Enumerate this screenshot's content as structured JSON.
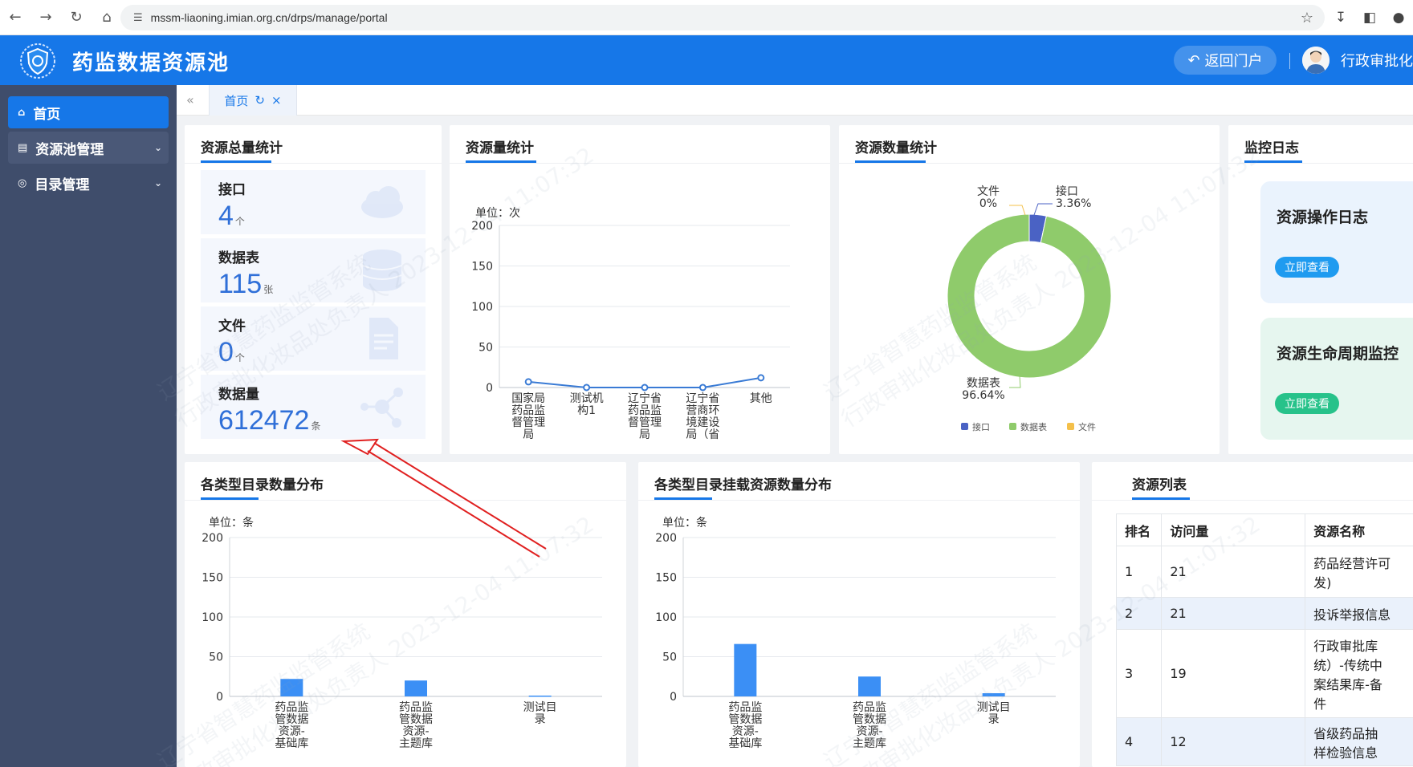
{
  "browser": {
    "url": "mssm-liaoning.imian.org.cn/drps/manage/portal"
  },
  "header": {
    "title": "药监数据资源池",
    "back_button": "返回门户",
    "user_name": "行政审批化"
  },
  "sidebar": {
    "items": [
      {
        "label": "首页"
      },
      {
        "label": "资源池管理"
      },
      {
        "label": "目录管理"
      }
    ]
  },
  "tabs": [
    {
      "label": "首页"
    }
  ],
  "watermark": {
    "line1": "辽宁省智慧药监监管系统",
    "line2": "行政审批化妆品处负责人 2023-12-04 11:07:32"
  },
  "total_stats": {
    "title": "资源总量统计",
    "items": [
      {
        "label": "接口",
        "value": "4",
        "unit": "个"
      },
      {
        "label": "数据表",
        "value": "115",
        "unit": "张"
      },
      {
        "label": "文件",
        "value": "0",
        "unit": "个"
      },
      {
        "label": "数据量",
        "value": "612472",
        "unit": "条"
      }
    ]
  },
  "resource_volume": {
    "title": "资源量统计",
    "unit_label": "单位：次"
  },
  "resource_count": {
    "title": "资源数量统计"
  },
  "monitor_log": {
    "title": "监控日志",
    "cards": [
      {
        "title": "资源操作日志",
        "button": "立即查看"
      },
      {
        "title": "资源生命周期监控",
        "button": "立即查看"
      }
    ]
  },
  "catalog_dist": {
    "title": "各类型目录数量分布",
    "unit_label": "单位：条"
  },
  "catalog_resource_dist": {
    "title": "各类型目录挂载资源数量分布",
    "unit_label": "单位：条"
  },
  "resource_list": {
    "title": "资源列表",
    "columns": [
      "排名",
      "访问量",
      "资源名称"
    ],
    "rows": [
      {
        "rank": "1",
        "visits": "21",
        "name_lines": [
          "药品经营许可",
          "发)"
        ]
      },
      {
        "rank": "2",
        "visits": "21",
        "name_lines": [
          "投诉举报信息"
        ]
      },
      {
        "rank": "3",
        "visits": "19",
        "name_lines": [
          "行政审批库",
          "统）-传统中",
          "案结果库-备",
          "件"
        ]
      },
      {
        "rank": "4",
        "visits": "12",
        "name_lines": [
          "省级药品抽",
          "样检验信息"
        ]
      }
    ]
  },
  "chart_data": [
    {
      "type": "line",
      "title": "资源量统计",
      "ylabel": "单位：次",
      "ylim": [
        0,
        200
      ],
      "yticks": [
        0,
        50,
        100,
        150,
        200
      ],
      "categories": [
        [
          "国家局",
          "药品监",
          "督管理",
          "局"
        ],
        [
          "测试机",
          "构1"
        ],
        [
          "辽宁省",
          "药品监",
          "督管理",
          "局"
        ],
        [
          "辽宁省",
          "营商环",
          "境建设",
          "局（省"
        ],
        [
          "其他"
        ]
      ],
      "values": [
        7,
        0,
        0,
        0,
        12
      ],
      "color": "#3a7bd5"
    },
    {
      "type": "pie",
      "title": "资源数量统计",
      "legend": [
        "接口",
        "数据表",
        "文件"
      ],
      "legend_position": "bottom",
      "slices": [
        {
          "name": "接口",
          "percent": 3.36,
          "label": "3.36%",
          "color": "#4a62c4"
        },
        {
          "name": "数据表",
          "percent": 96.64,
          "label": "96.64%",
          "color": "#8fcb6b"
        },
        {
          "name": "文件",
          "percent": 0,
          "label": "0%",
          "color": "#f4c04a"
        }
      ]
    },
    {
      "type": "bar",
      "title": "各类型目录数量分布",
      "ylabel": "单位：条",
      "ylim": [
        0,
        200
      ],
      "yticks": [
        0,
        50,
        100,
        150,
        200
      ],
      "categories": [
        [
          "药品监",
          "管数据",
          "资源-",
          "基础库"
        ],
        [
          "药品监",
          "管数据",
          "资源-",
          "主题库"
        ],
        [
          "测试目",
          "录"
        ]
      ],
      "values": [
        22,
        20,
        1
      ],
      "color": "#3b8ff5"
    },
    {
      "type": "bar",
      "title": "各类型目录挂载资源数量分布",
      "ylabel": "单位：条",
      "ylim": [
        0,
        200
      ],
      "yticks": [
        0,
        50,
        100,
        150,
        200
      ],
      "categories": [
        [
          "药品监",
          "管数据",
          "资源-",
          "基础库"
        ],
        [
          "药品监",
          "管数据",
          "资源-",
          "主题库"
        ],
        [
          "测试目",
          "录"
        ]
      ],
      "values": [
        66,
        25,
        4
      ],
      "color": "#3b8ff5"
    }
  ]
}
